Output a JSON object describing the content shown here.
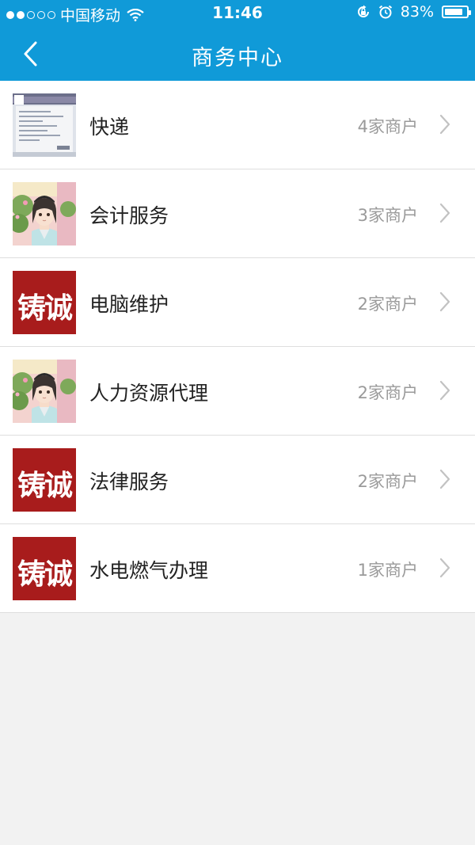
{
  "status_bar": {
    "carrier": "中国移动",
    "time": "11:46",
    "battery": "83%",
    "battery_level": 0.83,
    "signal_bars_filled": 2,
    "signal_bars_total": 5
  },
  "header": {
    "title": "商务中心",
    "background_color": "#109ad8"
  },
  "logo_text": "铸诚",
  "items": [
    {
      "label": "快递",
      "count": "4家商户",
      "icon": "screenshot-thumbnail"
    },
    {
      "label": "会计服务",
      "count": "3家商户",
      "icon": "avatar-character"
    },
    {
      "label": "电脑维护",
      "count": "2家商户",
      "icon": "zhucheng-logo"
    },
    {
      "label": "人力资源代理",
      "count": "2家商户",
      "icon": "avatar-character"
    },
    {
      "label": "法律服务",
      "count": "2家商户",
      "icon": "zhucheng-logo"
    },
    {
      "label": "水电燃气办理",
      "count": "1家商户",
      "icon": "zhucheng-logo"
    }
  ]
}
